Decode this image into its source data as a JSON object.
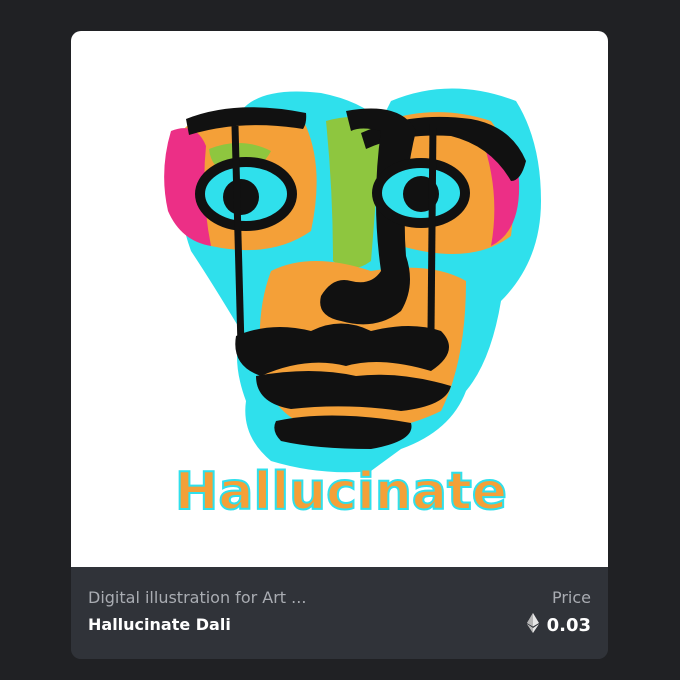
{
  "card": {
    "artwork_caption": "Hallucinate",
    "collection": "Digital illustration for Art ...",
    "item_name": "Hallucinate Dali",
    "price_label": "Price",
    "price_value": "0.03",
    "currency_icon": "ethereum-icon"
  },
  "colors": {
    "page_background": "#202124",
    "card_footer": "#303339",
    "cyan": "#2fe0ec",
    "orange": "#f4a038",
    "pink": "#ec2f86",
    "green": "#8ec63f",
    "ink": "#111111"
  }
}
